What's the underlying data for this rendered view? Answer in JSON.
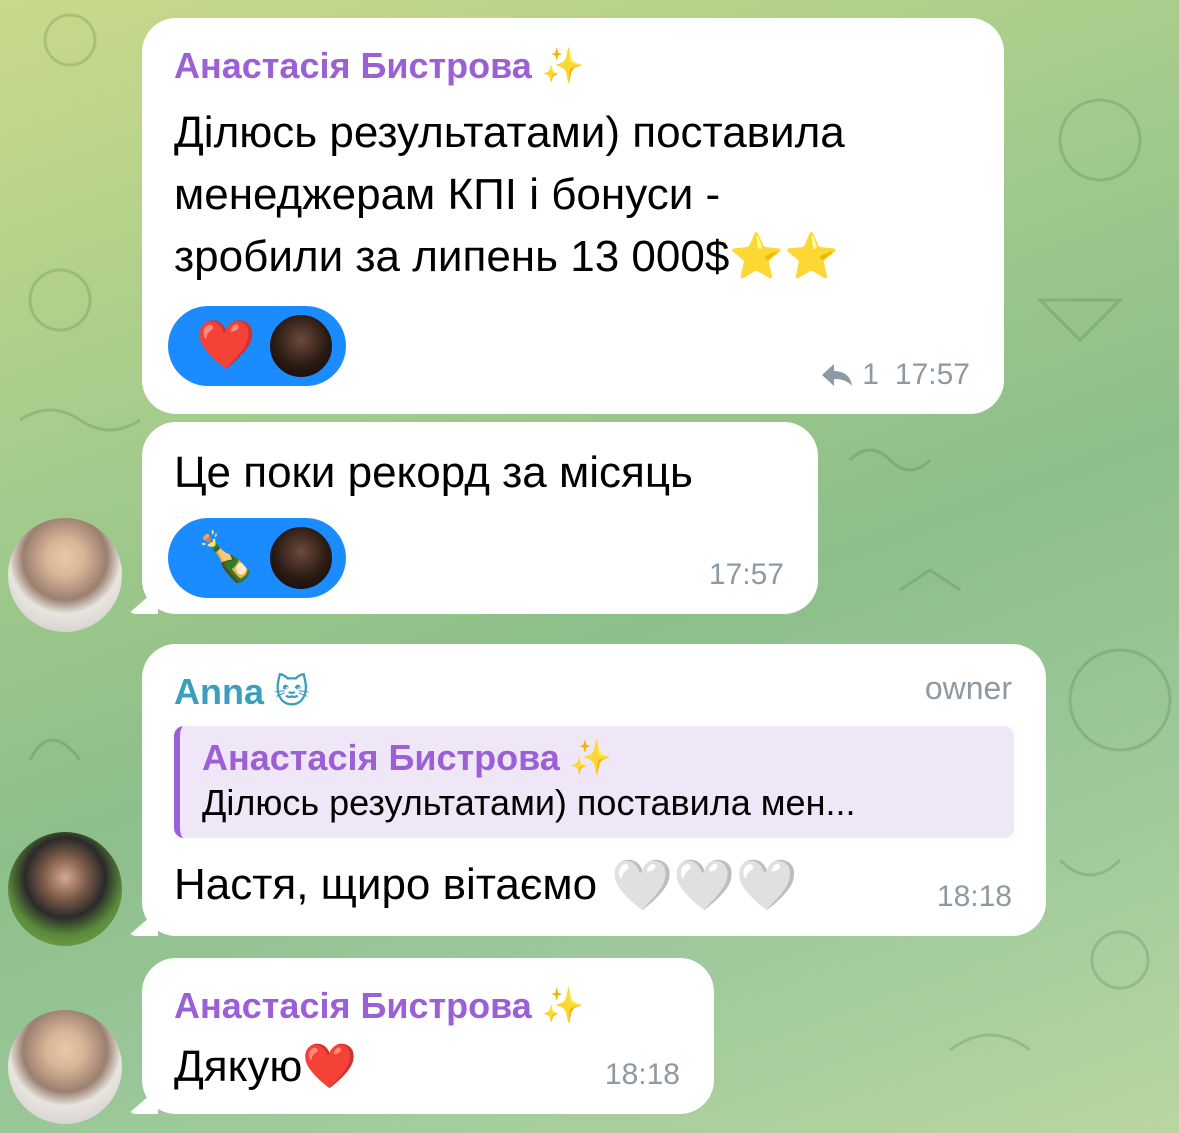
{
  "messages": [
    {
      "sender": "Анастасія Бистрова",
      "sender_badge": "✨",
      "lines": [
        "Ділюсь результатами) поставила",
        "менеджерам КПІ і бонуси -",
        "зробили за липень 13 000$⭐⭐"
      ],
      "reactions": {
        "emoji": "❤️"
      },
      "replies": "1",
      "time": "17:57"
    },
    {
      "lines": [
        "Це поки рекорд за місяць"
      ],
      "reactions": {
        "emoji": "🍾"
      },
      "time": "17:57"
    },
    {
      "sender": "Anna",
      "sender_badge": "🐱",
      "role": "owner",
      "quote": {
        "sender": "Анастасія Бистрова",
        "sender_badge": "✨",
        "text": "Ділюсь результатами) поставила мен..."
      },
      "text": "Настя, щиро вітаємо",
      "text_emoji": "🤍🤍🤍",
      "time": "18:18"
    },
    {
      "sender": "Анастасія Бистрова",
      "sender_badge": "✨",
      "text": "Дякую❤️",
      "time": "18:18"
    }
  ],
  "colors": {
    "sender_purple": "#9b5fd6",
    "sender_blue": "#3a9fbf",
    "reaction_bg": "#1a8cff",
    "meta_gray": "#8e9aa3"
  }
}
